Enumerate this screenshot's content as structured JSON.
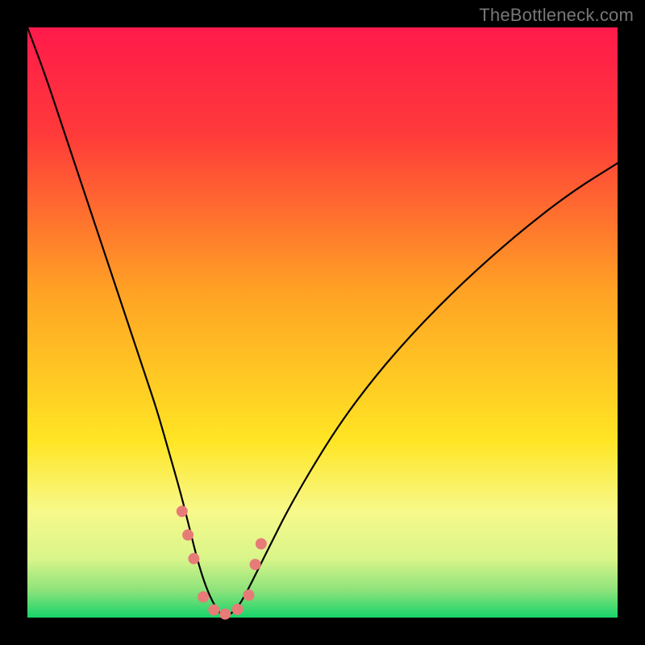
{
  "watermark": "TheBottleneck.com",
  "chart_data": {
    "type": "line",
    "title": "",
    "xlabel": "",
    "ylabel": "",
    "x_range": [
      0,
      100
    ],
    "y_range": [
      0,
      100
    ],
    "grid": false,
    "legend": false,
    "background_gradient": {
      "stops": [
        {
          "offset": 0.0,
          "color": "#ff1a4b"
        },
        {
          "offset": 0.18,
          "color": "#ff3a3a"
        },
        {
          "offset": 0.45,
          "color": "#ffa324"
        },
        {
          "offset": 0.7,
          "color": "#ffe524"
        },
        {
          "offset": 0.82,
          "color": "#f7f98a"
        },
        {
          "offset": 0.9,
          "color": "#d9f58a"
        },
        {
          "offset": 0.955,
          "color": "#8be27a"
        },
        {
          "offset": 1.0,
          "color": "#17d36a"
        }
      ]
    },
    "series": [
      {
        "name": "bottleneck-curve",
        "stroke": "#000000",
        "stroke_width": 2.2,
        "x": [
          0,
          3,
          6,
          9,
          12,
          15,
          18,
          20,
          22,
          24,
          26,
          27.5,
          29,
          30.5,
          32,
          33,
          34,
          35.5,
          37,
          39,
          41,
          44,
          48,
          53,
          59,
          66,
          74,
          83,
          92,
          100
        ],
        "y": [
          100,
          92,
          83,
          74,
          65,
          56,
          47,
          41,
          35,
          28,
          21,
          15,
          9,
          4.5,
          1.5,
          0.3,
          0.3,
          1.5,
          4,
          8,
          12,
          18,
          25,
          33,
          41,
          49,
          57,
          65,
          72,
          77
        ]
      }
    ],
    "markers": {
      "color": "#e77b78",
      "radius": 7,
      "points": [
        {
          "x": 26.2,
          "y": 18
        },
        {
          "x": 27.2,
          "y": 14
        },
        {
          "x": 28.2,
          "y": 10
        },
        {
          "x": 29.8,
          "y": 3.5
        },
        {
          "x": 31.6,
          "y": 1.3
        },
        {
          "x": 33.5,
          "y": 0.6
        },
        {
          "x": 35.6,
          "y": 1.4
        },
        {
          "x": 37.5,
          "y": 3.8
        },
        {
          "x": 38.6,
          "y": 9
        },
        {
          "x": 39.6,
          "y": 12.5
        }
      ]
    }
  }
}
